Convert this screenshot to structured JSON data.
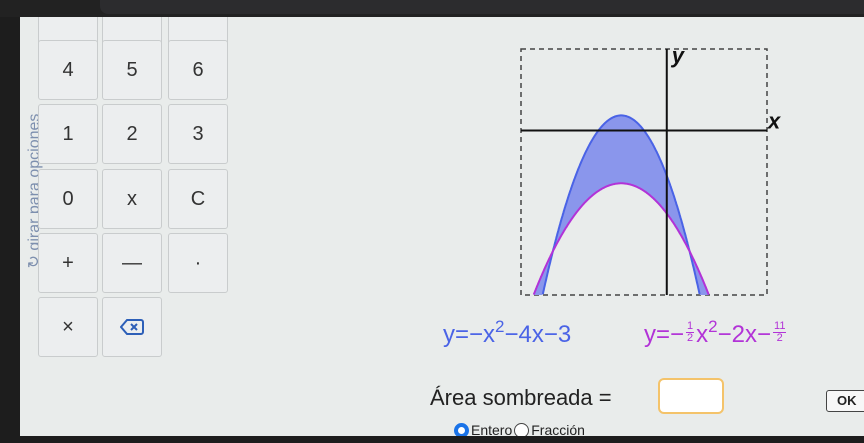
{
  "sidebar": {
    "rotate_label": "↻ girar para opciones"
  },
  "keypad": {
    "rows": [
      [
        "4",
        "5",
        "6"
      ],
      [
        "1",
        "2",
        "3"
      ],
      [
        "0",
        "x",
        "C"
      ],
      [
        "+",
        "—",
        "·"
      ],
      [
        "×",
        "⌫"
      ]
    ]
  },
  "graph": {
    "y_label": "y",
    "x_label": "x"
  },
  "equations": {
    "eq1": {
      "lhs": "y=−x",
      "exp": "2",
      "rest": "−4x−3"
    },
    "eq2": {
      "lhs": "y=−",
      "frac1_num": "1",
      "frac1_den": "2",
      "mid": "x",
      "exp": "2",
      "tail": "−2x−",
      "frac2_num": "11",
      "frac2_den": "2"
    }
  },
  "chart_data": {
    "type": "area",
    "series": [
      {
        "name": "y=-x^2-4x-3",
        "color": "#4a63e6",
        "coefficients": [
          -1,
          -4,
          -3
        ]
      },
      {
        "name": "y=-1/2x^2-2x-11/2",
        "color": "#b233d7",
        "coefficients": [
          -0.5,
          -2,
          -5.5
        ]
      }
    ],
    "shaded_region": "between curves",
    "shade_color": "#8a96ec",
    "xlim": [
      -6.4,
      4.4
    ],
    "ylim": [
      -10.9,
      5.4
    ]
  },
  "answer": {
    "label": "Área sombreada =",
    "value": "",
    "ok_label": "OK"
  },
  "options": {
    "integer_label": "Entero",
    "fraction_label": "Fracción",
    "selected": "Entero"
  }
}
